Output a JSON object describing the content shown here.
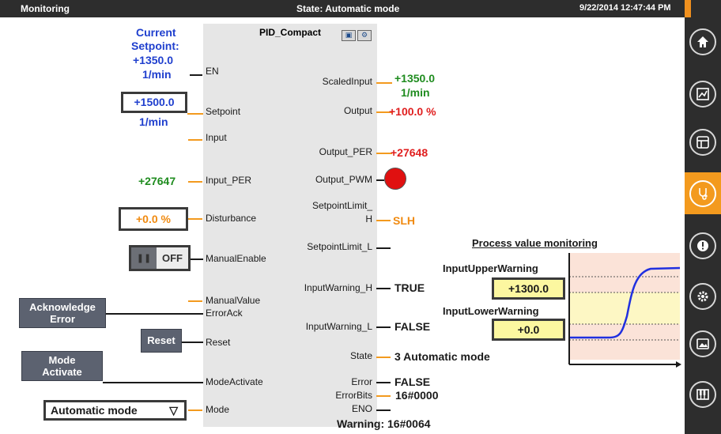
{
  "header": {
    "title": "Monitoring",
    "state": "State: Automatic mode",
    "datetime": "9/22/2014 12:47:44 PM"
  },
  "nav": [
    {
      "name": "home",
      "icon": "home-icon"
    },
    {
      "name": "trend",
      "icon": "trend-chart-icon"
    },
    {
      "name": "layout",
      "icon": "layout-icon"
    },
    {
      "name": "diagnostics",
      "icon": "stethoscope-icon",
      "active": true
    },
    {
      "name": "alarms",
      "icon": "alarm-warning-icon"
    },
    {
      "name": "settings",
      "icon": "gear-icon"
    },
    {
      "name": "image",
      "icon": "image-icon"
    },
    {
      "name": "keyboard",
      "icon": "piano-keys-icon"
    }
  ],
  "block": {
    "title": "PID_Compact"
  },
  "inputs": {
    "current_setpoint_label_1": "Current",
    "current_setpoint_label_2": "Setpoint:",
    "current_setpoint_value": "+1350.0",
    "current_setpoint_unit": "1/min",
    "setpoint_value": "+1500.0",
    "setpoint_unit": "1/min",
    "input_per_value": "+27647",
    "disturbance_value": "+0.0 %",
    "manual_toggle_label": "OFF",
    "ack_button_line1": "Acknowledge",
    "ack_button_line2": "Error",
    "reset_button": "Reset",
    "mode_button_line1": "Mode",
    "mode_button_line2": "Activate",
    "mode_selected": "Automatic mode"
  },
  "pins_in": {
    "en": "EN",
    "setpoint": "Setpoint",
    "input": "Input",
    "input_per": "Input_PER",
    "disturbance": "Disturbance",
    "manual_enable": "ManualEnable",
    "manual_value": "ManualValue",
    "error_ack": "ErrorAck",
    "reset": "Reset",
    "mode_activate": "ModeActivate",
    "mode": "Mode"
  },
  "pins_out": {
    "scaled_input": "ScaledInput",
    "output": "Output",
    "output_per": "Output_PER",
    "output_pwm": "Output_PWM",
    "setpoint_limit_h_1": "SetpointLimit_",
    "setpoint_limit_h_2": "H",
    "setpoint_limit_l": "SetpointLimit_L",
    "input_warning_h": "InputWarning_H",
    "input_warning_l": "InputWarning_L",
    "state": "State",
    "error": "Error",
    "error_bits": "ErrorBits",
    "eno": "ENO"
  },
  "outputs": {
    "scaled_input_value": "+1350.0",
    "scaled_input_unit": "1/min",
    "output_value": "+100.0 %",
    "output_per_value": "+27648",
    "setpoint_limit_h_value": "SLH",
    "input_warning_h_value": "TRUE",
    "input_warning_l_value": "FALSE",
    "state_value": "3  Automatic mode",
    "error_value": "FALSE",
    "error_bits_value": "16#0000",
    "warning_value": "Warning: 16#0064"
  },
  "monitor": {
    "title": "Process value monitoring",
    "upper_label": "InputUpperWarning",
    "upper_value": "+1300.0",
    "lower_label": "InputLowerWarning",
    "lower_value": "+0.0"
  },
  "colors": {
    "accent": "#f39a1e",
    "header_bg": "#2d2d2d",
    "setpoint_blue": "#1f3fce",
    "output_red": "#e01e1e",
    "scaled_green": "#1f8c1f"
  }
}
